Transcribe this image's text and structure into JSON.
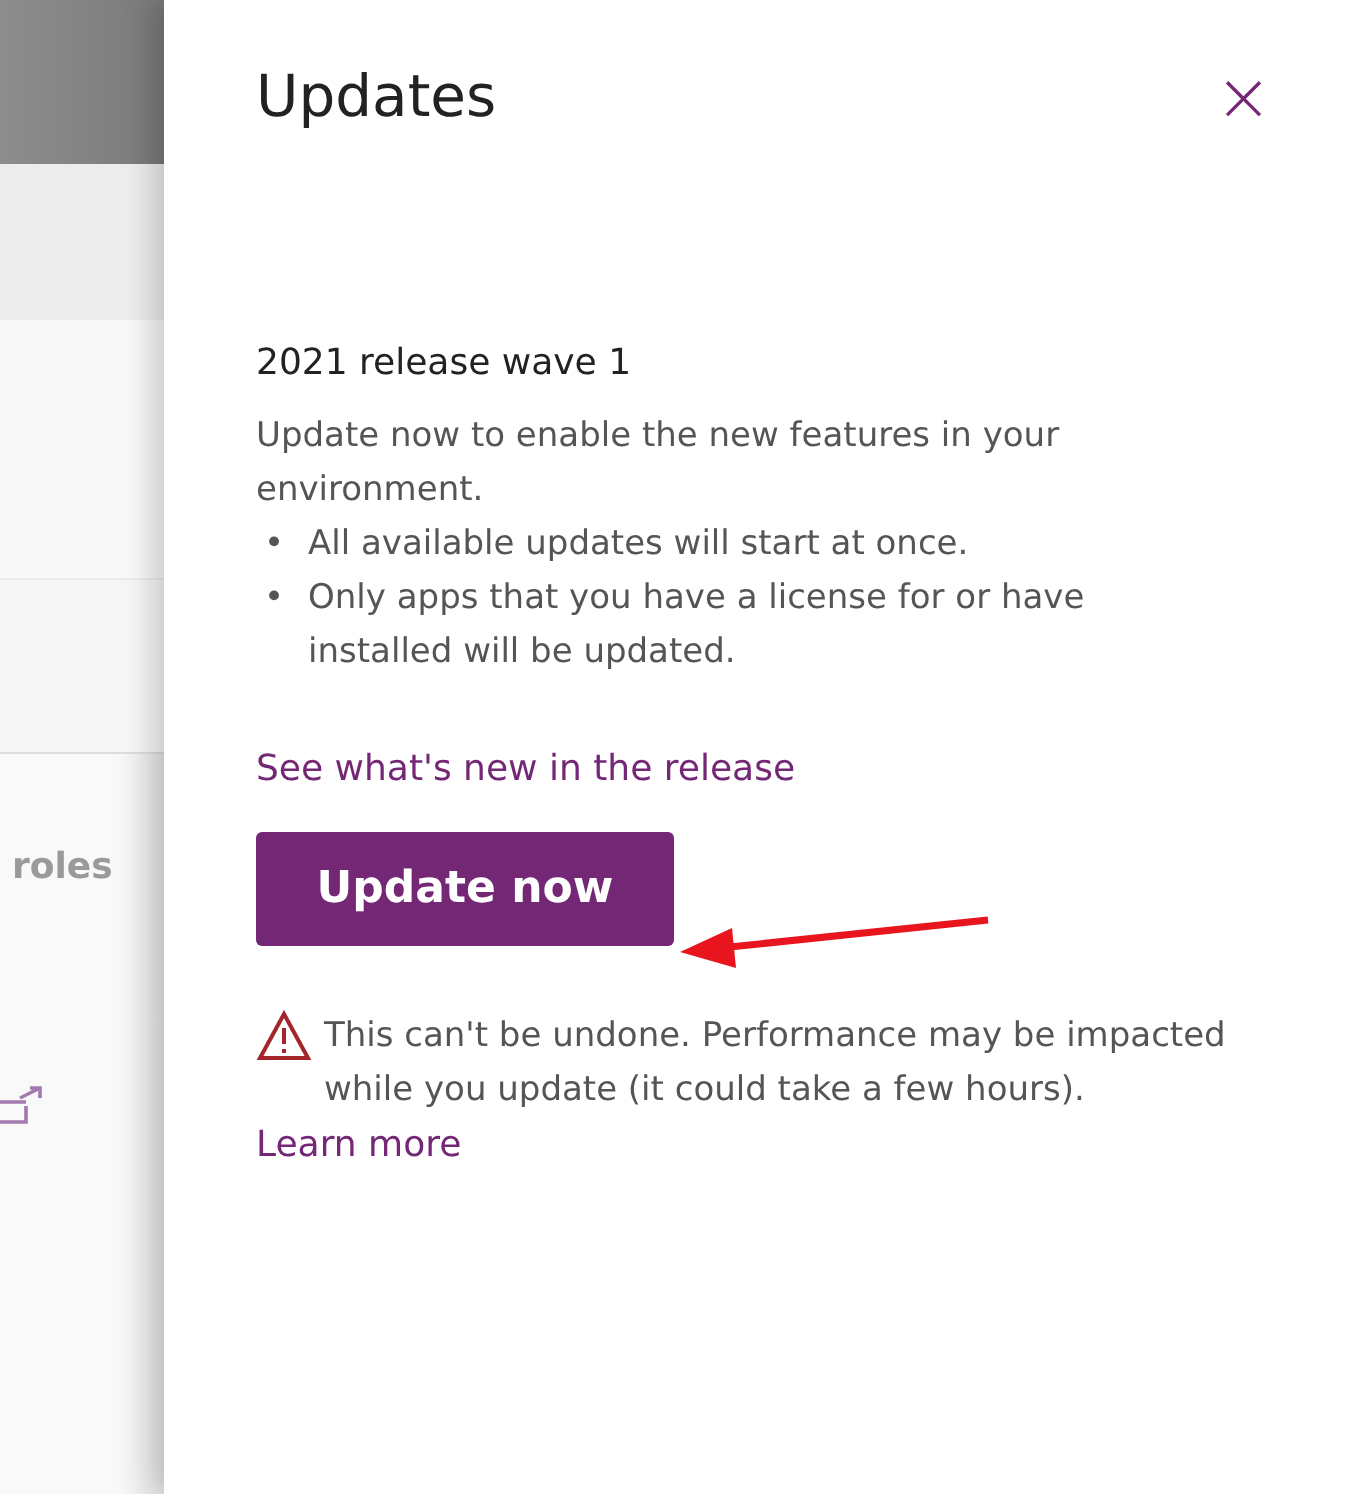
{
  "background": {
    "section_label": "roles"
  },
  "panel": {
    "title": "Updates",
    "close": "×",
    "heading": "2021 release wave 1",
    "description": "Update now to enable the new features in your environment.",
    "bullets": [
      {
        "marker": "•",
        "text": "All available updates will start at once."
      },
      {
        "marker": "•",
        "text": "Only apps that you have a license for or have installed will be updated."
      }
    ],
    "whats_new_link": "See what's new in the release",
    "button": "Update now",
    "warning": "This can't be undone. Performance may be impacted while you update (it could take a few hours).",
    "learn_more_link": "Learn more"
  }
}
